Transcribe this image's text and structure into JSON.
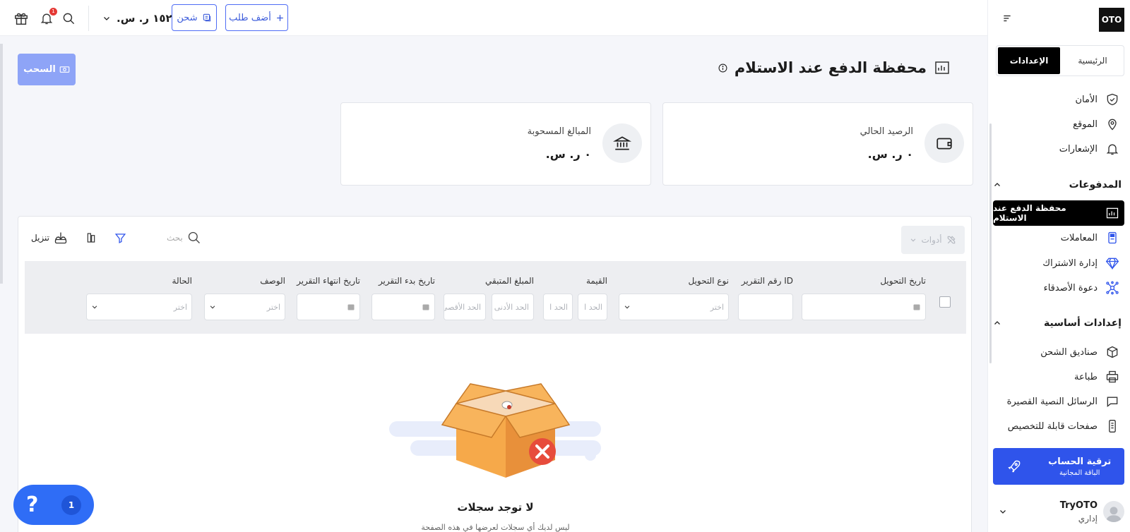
{
  "topbar": {
    "balance": "١٥٢ ر. س.",
    "recharge_label": "شحن",
    "add_order_label": "أضف طلب",
    "notification_count": "1"
  },
  "sidebar": {
    "logo": "OTO",
    "tabs": {
      "home": "الرئيسية",
      "settings": "الإعدادات"
    },
    "items_top": [
      {
        "label": "الأمان",
        "icon": "shield-icon"
      },
      {
        "label": "الموقع",
        "icon": "location-pin-icon"
      },
      {
        "label": "الإشعارات",
        "icon": "bell-icon"
      }
    ],
    "payments_section": "المدفوعات",
    "payments_items": [
      {
        "label": "محفظة الدفع عند الاستلام",
        "icon": "cod-wallet-icon",
        "active": true
      },
      {
        "label": "المعاملات",
        "icon": "pos-terminal-icon"
      },
      {
        "label": "إدارة الاشتراك",
        "icon": "diamond-icon"
      },
      {
        "label": "دعوة الأصدقاء",
        "icon": "network-icon"
      }
    ],
    "basic_section": "إعدادات أساسية",
    "basic_items": [
      {
        "label": "صناديق الشحن",
        "icon": "box-icon"
      },
      {
        "label": "طباعة",
        "icon": "printer-icon"
      },
      {
        "label": "الرسائل النصية القصيرة",
        "icon": "sms-icon"
      },
      {
        "label": "صفحات قابلة للتخصيص",
        "icon": "mobile-page-icon"
      }
    ],
    "upgrade": {
      "title": "ترقية الحساب",
      "subtitle": "الباقة المجانية"
    },
    "user": {
      "name": "TryOTO",
      "role": "إداري"
    }
  },
  "page": {
    "title": "محفظة الدفع عند الاستلام",
    "withdraw_label": "السحب"
  },
  "cards": [
    {
      "label": "الرصيد الحالي",
      "value": "٠ ر. س.",
      "icon": "wallet-icon"
    },
    {
      "label": "المبالغ المسحوبة",
      "value": "٠ ر. س.",
      "icon": "bank-icon"
    }
  ],
  "toolbar": {
    "tools_label": "أدوات",
    "search_placeholder": "بحث",
    "download_label": "تنزيل"
  },
  "columns": [
    {
      "label": "تاريخ التحويل"
    },
    {
      "label": "رقم التقرير ID"
    },
    {
      "label": "نوع التحويل",
      "placeholder": "اختر"
    },
    {
      "label": "القيمة",
      "min": "الحد ا",
      "max": "الحد ا"
    },
    {
      "label": "المبلغ المتبقي",
      "min": "الحد الأدنى",
      "max": "الحد الأقصى"
    },
    {
      "label": "تاريخ بدء التقرير"
    },
    {
      "label": "تاريخ انتهاء التقرير"
    },
    {
      "label": "الوصف",
      "placeholder": "اختر"
    },
    {
      "label": "الحالة",
      "placeholder": "اختر"
    }
  ],
  "empty": {
    "title": "لا توجد سجلات",
    "subtitle": "ليس لديك أي سجلات لعرضها في هذه الصفحة"
  },
  "help": {
    "count": "1",
    "symbol": "?"
  }
}
